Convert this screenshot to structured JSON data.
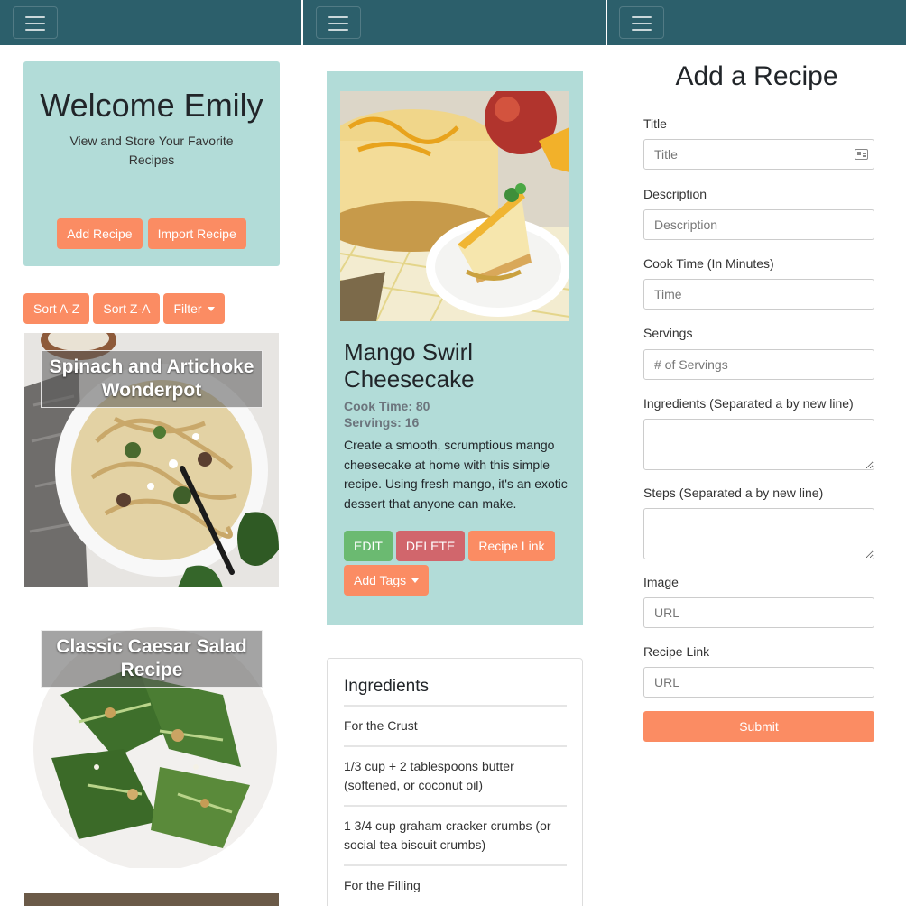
{
  "panel1": {
    "welcome": {
      "title": "Welcome Emily",
      "subtitle": "View and Store Your Favorite Recipes",
      "add_recipe": "Add Recipe",
      "import_recipe": "Import Recipe"
    },
    "sort": {
      "az": "Sort A-Z",
      "za": "Sort Z-A",
      "filter": "Filter"
    },
    "cards": [
      {
        "title": "Spinach and Artichoke Wonderpot"
      },
      {
        "title": "Classic Caesar Salad Recipe"
      }
    ]
  },
  "panel2": {
    "recipe": {
      "title": "Mango Swirl Cheesecake",
      "cook_time": "Cook Time: 80",
      "servings": "Servings: 16",
      "description": "Create a smooth, scrumptious mango cheesecake at home with this simple recipe. Using fresh mango, it's an exotic dessert that anyone can make.",
      "edit": "EDIT",
      "delete": "DELETE",
      "recipe_link": "Recipe Link",
      "add_tags": "Add Tags"
    },
    "ingredients": {
      "heading": "Ingredients",
      "items": [
        "For the Crust",
        "1/3 cup + 2 tablespoons butter (softened, or coconut oil)",
        "1 3/4 cup graham cracker crumbs (or social tea biscuit crumbs)",
        "For the Filling"
      ]
    }
  },
  "panel3": {
    "form_title": "Add a Recipe",
    "fields": {
      "title": {
        "label": "Title",
        "placeholder": "Title"
      },
      "description": {
        "label": "Description",
        "placeholder": "Description"
      },
      "cook_time": {
        "label": "Cook Time (In Minutes)",
        "placeholder": "Time"
      },
      "servings": {
        "label": "Servings",
        "placeholder": "# of Servings"
      },
      "ingredients": {
        "label": "Ingredients (Separated a by new line)",
        "placeholder": ""
      },
      "steps": {
        "label": "Steps (Separated a by new line)",
        "placeholder": ""
      },
      "image": {
        "label": "Image",
        "placeholder": "URL"
      },
      "recipe_link": {
        "label": "Recipe Link",
        "placeholder": "URL"
      }
    },
    "submit": "Submit"
  },
  "colors": {
    "navbar": "#2c5f6b",
    "card_bg": "#b2dcd8",
    "accent_orange": "#fb8c63",
    "edit_green": "#6bba71",
    "delete_red": "#d1666c"
  },
  "icons": [
    "hamburger-menu-icon",
    "id-card-icon",
    "caret-down-icon"
  ]
}
